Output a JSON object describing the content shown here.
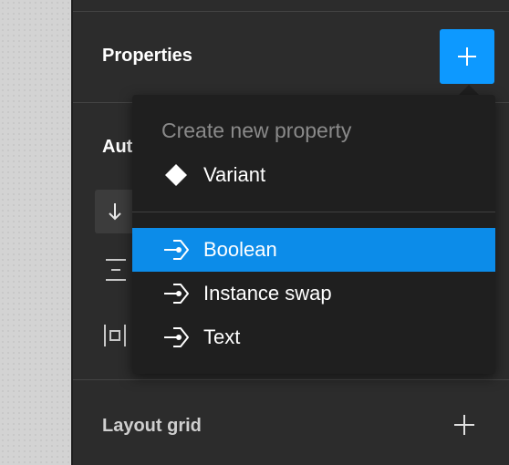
{
  "panel": {
    "sections": {
      "properties_title": "Properties",
      "auto_layout_title_partial": "Aut",
      "layout_grid_title": "Layout grid"
    }
  },
  "dropdown": {
    "header": "Create new property",
    "items": [
      {
        "label": "Variant",
        "icon": "diamond-icon",
        "active": false
      },
      {
        "label": "Boolean",
        "icon": "property-enter-icon",
        "active": true
      },
      {
        "label": "Instance swap",
        "icon": "property-enter-icon",
        "active": false
      },
      {
        "label": "Text",
        "icon": "property-enter-icon",
        "active": false
      }
    ]
  },
  "colors": {
    "accent": "#0d99ff",
    "highlight": "#0c8ce9",
    "panel_bg": "#2c2c2c",
    "menu_bg": "#1f1f1f"
  }
}
